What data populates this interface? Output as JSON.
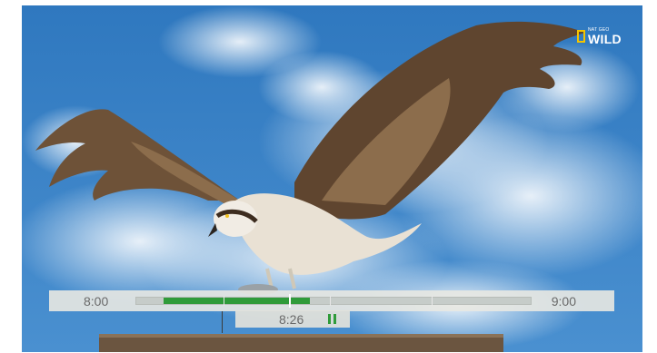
{
  "channel": {
    "logo_small": "NAT GEO",
    "logo_big": "WILD",
    "logo_icon": "nat-geo-yellow-frame-icon",
    "accent": "#f4c400"
  },
  "timeline": {
    "start_time": "8:00",
    "end_time": "9:00",
    "progress_fraction": 0.44,
    "fill_color": "#2f9b3a"
  },
  "scrubber": {
    "current_time": "8:26",
    "state_icon": "pause-icon"
  }
}
